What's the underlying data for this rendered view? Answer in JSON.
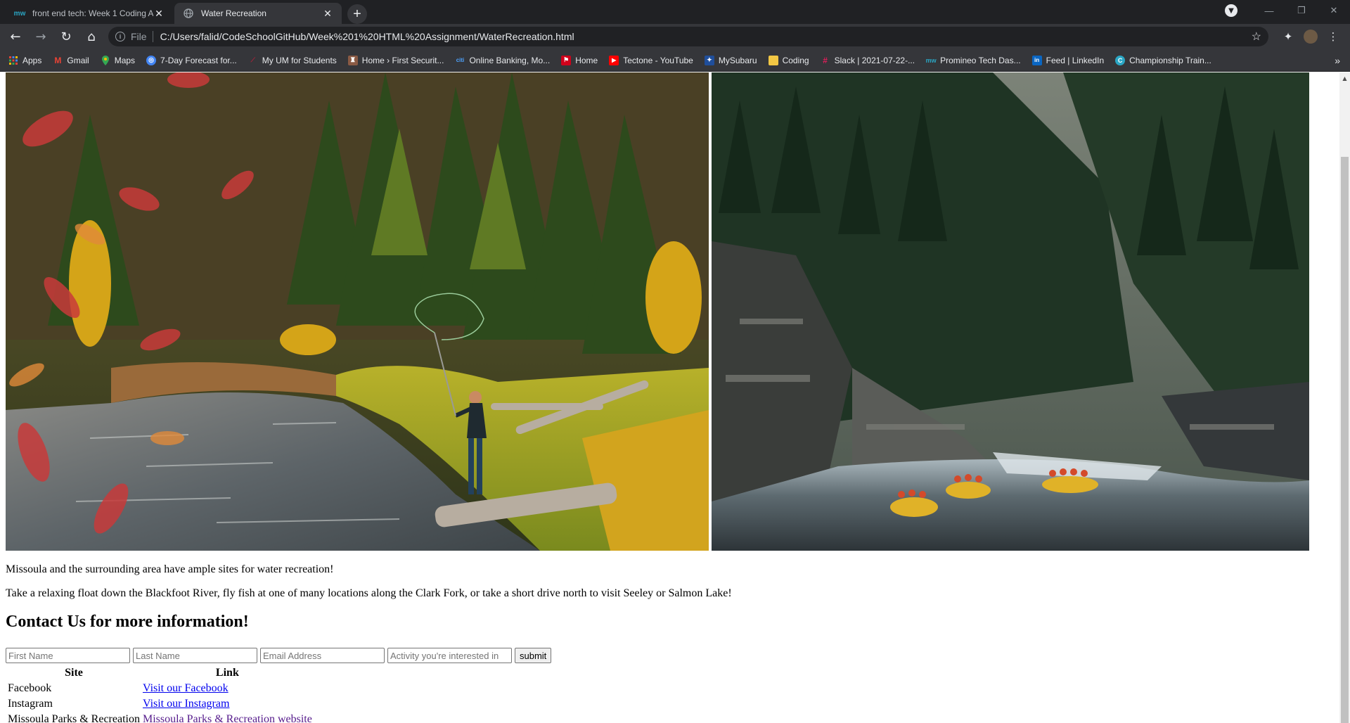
{
  "browser": {
    "tabs": [
      {
        "title": "front end tech: Week 1 Coding A",
        "active": false,
        "favicon": "mw-favicon-icon"
      },
      {
        "title": "Water Recreation",
        "active": true,
        "favicon": "globe-icon"
      }
    ],
    "new_tab_label": "+",
    "address": {
      "scheme": "File",
      "url": "C:/Users/falid/CodeSchoolGitHub/Week%201%20HTML%20Assignment/WaterRecreation.html"
    },
    "bookmarks": [
      {
        "label": "Apps",
        "icon": "apps-grid-icon",
        "color": "#ea4335"
      },
      {
        "label": "Gmail",
        "icon": "gmail-icon",
        "color": "#ea4335"
      },
      {
        "label": "Maps",
        "icon": "maps-pin-icon",
        "color": "#34a853"
      },
      {
        "label": "7-Day Forecast for...",
        "icon": "weather-icon",
        "color": "#4285f4"
      },
      {
        "label": "My UM for Students",
        "icon": "um-icon",
        "color": "#7a1a2e"
      },
      {
        "label": "Home › First Securit...",
        "icon": "bank-icon",
        "color": "#8a5a44"
      },
      {
        "label": "Online Banking, Mo...",
        "icon": "citi-icon",
        "color": "#1a4a8a"
      },
      {
        "label": "Home",
        "icon": "home-flag-icon",
        "color": "#d0021b"
      },
      {
        "label": "Tectone - YouTube",
        "icon": "youtube-icon",
        "color": "#ff0000"
      },
      {
        "label": "MySubaru",
        "icon": "subaru-icon",
        "color": "#1f4e9b"
      },
      {
        "label": "Coding",
        "icon": "folder-icon",
        "color": "#f2c744"
      },
      {
        "label": "Slack | 2021-07-22-...",
        "icon": "slack-icon",
        "color": "#4a154b"
      },
      {
        "label": "Promineo Tech Das...",
        "icon": "mw-icon",
        "color": "#0b6e99"
      },
      {
        "label": "Feed | LinkedIn",
        "icon": "linkedin-icon",
        "color": "#0a66c2"
      },
      {
        "label": "Championship Train...",
        "icon": "training-icon",
        "color": "#2aa6c4"
      }
    ]
  },
  "page": {
    "images": [
      {
        "name": "fly-fishing-photo",
        "alt": "Woman fly fishing on river bank"
      },
      {
        "name": "rafting-photo",
        "alt": "Rafts on river canyon"
      }
    ],
    "intro": "Missoula and the surrounding area have ample sites for water recreation!",
    "details": "Take a relaxing float down the Blackfoot River, fly fish at one of many locations along the Clark Fork, or take a short drive north to visit Seeley or Salmon Lake!",
    "contact_heading": "Contact Us for more information!",
    "form": {
      "first_name_placeholder": "First Name",
      "last_name_placeholder": "Last Name",
      "email_placeholder": "Email Address",
      "activity_placeholder": "Activity you're interested in",
      "submit_label": "submit"
    },
    "table": {
      "headers": [
        "Site",
        "Link"
      ],
      "rows": [
        {
          "site": "Facebook",
          "link": "Visit our Facebook"
        },
        {
          "site": "Instagram",
          "link": "Visit our Instagram"
        },
        {
          "site": "Missoula Parks & Recreation",
          "link": "Missoula Parks & Recreation website"
        }
      ]
    }
  }
}
